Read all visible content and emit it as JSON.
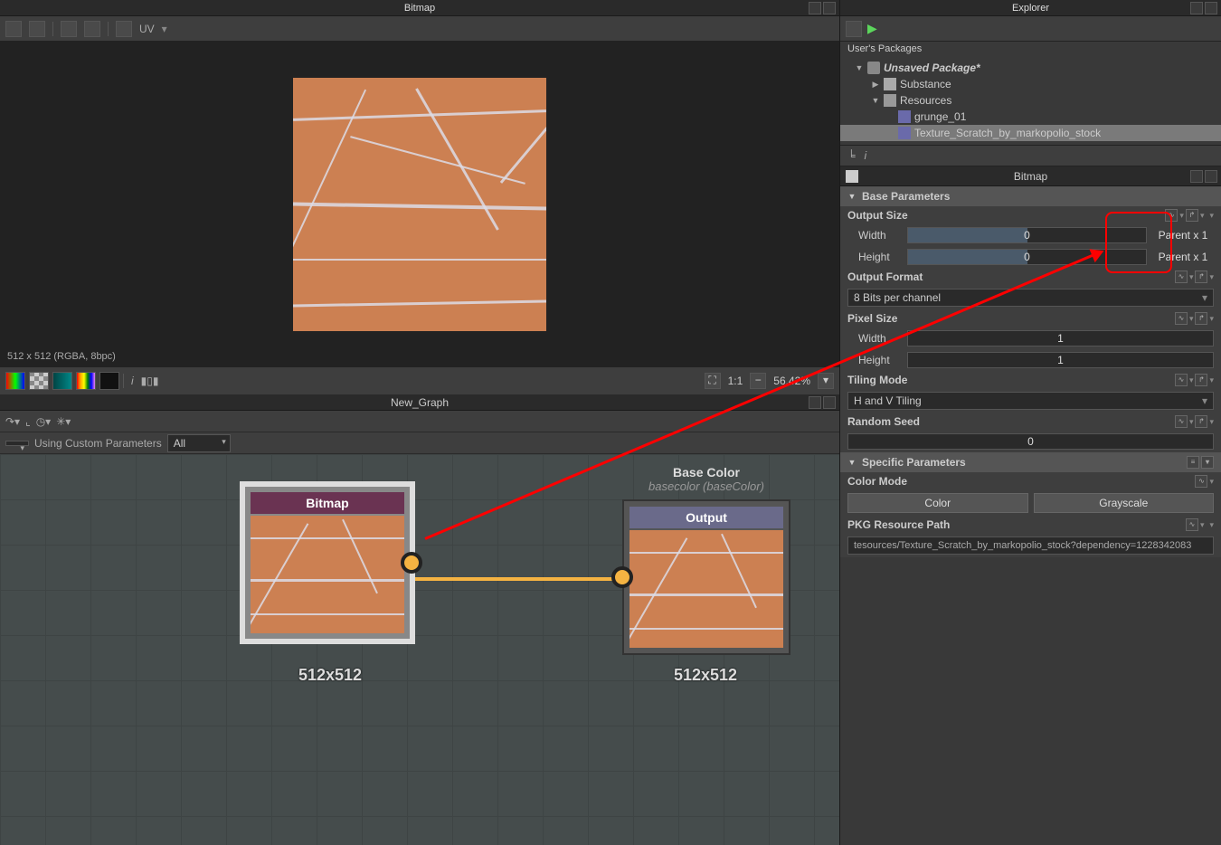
{
  "preview_panel_title": "Bitmap",
  "preview_toolbar_uv": "UV",
  "preview_status": "512 x 512 (RGBA, 8bpc)",
  "zoom_ratio": "1:1",
  "zoom_value": "56.42%",
  "graph_panel_title": "New_Graph",
  "graph_param_mode": "Using Custom Parameters",
  "graph_filter": "All",
  "node_bitmap_title": "Bitmap",
  "node_bitmap_size": "512x512",
  "node_output_title": "Output",
  "node_output_size": "512x512",
  "node_output_label1": "Base Color",
  "node_output_label2": "basecolor (baseColor)",
  "explorer_panel_title": "Explorer",
  "explorer_root": "User's Packages",
  "tree": {
    "pkg": "Unsaved Package*",
    "substance": "Substance",
    "resources": "Resources",
    "res1": "grunge_01",
    "res2": "Texture_Scratch_by_markopolio_stock"
  },
  "props_panel_title": "Bitmap",
  "section_base_params": "Base Parameters",
  "output_size": "Output Size",
  "width_label": "Width",
  "height_label": "Height",
  "width_value": "0",
  "height_value": "0",
  "parent_x1": "Parent x 1",
  "output_format": "Output Format",
  "output_format_value": "8 Bits per channel",
  "pixel_size": "Pixel Size",
  "pixel_width": "1",
  "pixel_height": "1",
  "tiling_mode": "Tiling Mode",
  "tiling_value": "H and V Tiling",
  "random_seed": "Random Seed",
  "random_seed_value": "0",
  "section_specific_params": "Specific Parameters",
  "color_mode": "Color Mode",
  "color_btn": "Color",
  "gray_btn": "Grayscale",
  "pkg_path": "PKG Resource Path",
  "pkg_path_value": "tesources/Texture_Scratch_by_markopolio_stock?dependency=1228342083"
}
